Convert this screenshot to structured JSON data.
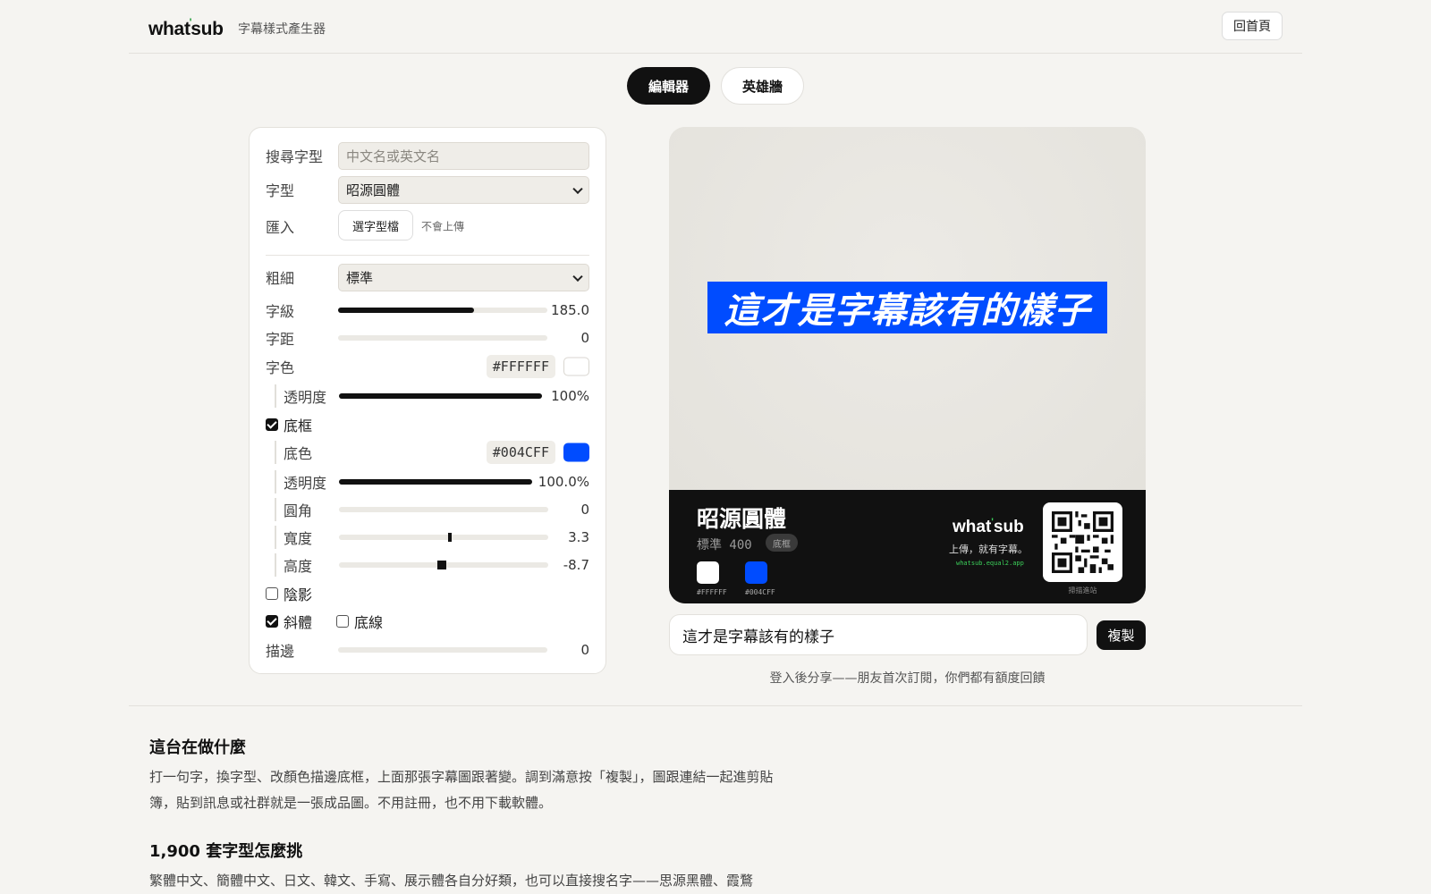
{
  "header": {
    "brand_pre": "what",
    "brand_tick": "'",
    "brand_post": "sub",
    "subtitle": "字幕樣式產生器",
    "home_label": "回首頁"
  },
  "tabs": [
    {
      "label": "編輯器",
      "active": true
    },
    {
      "label": "英雄牆",
      "active": false
    }
  ],
  "controls": {
    "search": {
      "label": "搜尋字型",
      "placeholder": "中文名或英文名"
    },
    "font": {
      "label": "字型",
      "value": "昭源圓體"
    },
    "import": {
      "label": "匯入",
      "button": "選字型檔",
      "hint": "不會上傳"
    },
    "weight": {
      "label": "粗細",
      "value": "標準"
    },
    "size": {
      "label": "字級",
      "value": "185.0",
      "fill": 0.65
    },
    "spacing": {
      "label": "字距",
      "value": "0",
      "fill": 0
    },
    "text_color": {
      "label": "字色",
      "hex": "#FFFFFF",
      "color": "#FFFFFF"
    },
    "text_opacity": {
      "label": "透明度",
      "value": "100%",
      "fill": 1.0
    },
    "box": {
      "label": "底框",
      "checked": true
    },
    "box_color": {
      "label": "底色",
      "hex": "#004CFF",
      "color": "#004CFF"
    },
    "box_opacity": {
      "label": "透明度",
      "value": "100.0%",
      "fill": 1.0
    },
    "radius": {
      "label": "圓角",
      "value": "0",
      "fill": 0
    },
    "width": {
      "label": "寬度",
      "value": "3.3",
      "knob": 0.52
    },
    "height": {
      "label": "高度",
      "value": "-8.7",
      "knob": 0.47
    },
    "shadow": {
      "label": "陰影",
      "checked": false
    },
    "italic": {
      "label": "斜體",
      "checked": true
    },
    "underline": {
      "label": "底線",
      "checked": false
    },
    "stroke": {
      "label": "描邊",
      "value": "0",
      "fill": 0
    }
  },
  "preview": {
    "caption": "這才是字幕該有的樣子",
    "caption_color": "#FFFFFF",
    "box_color": "#004CFF",
    "footer": {
      "font_name": "昭源圓體",
      "weight": "標準 400",
      "badge": "底框",
      "swatch1": {
        "hex": "#FFFFFF",
        "color": "#FFFFFF"
      },
      "swatch2": {
        "hex": "#004CFF",
        "color": "#004CFF"
      },
      "brand_pre": "what",
      "brand_tick": "'",
      "brand_post": "sub",
      "slogan": "上傳，就有字幕。",
      "url": "whatsub.equal2.app",
      "qr_label": "掃描進站"
    }
  },
  "text_input": {
    "value": "這才是字幕該有的樣子"
  },
  "copy_label": "複製",
  "share_note": "登入後分享——朋友首次訂閱，你們都有額度回饋",
  "sections": [
    {
      "title": "這台在做什麼",
      "body": "打一句字，換字型、改顏色描邊底框，上面那張字幕圖跟著變。調到滿意按「複製」，圖跟連結一起進剪貼簿，貼到訊息或社群就是一張成品圖。不用註冊，也不用下載軟體。"
    },
    {
      "title": "1,900 套字型怎麼挑",
      "body": "繁體中文、簡體中文、日文、韓文、手寫、展示體各自分好類，也可以直接搜名字——思源黑體、霞鶩"
    }
  ]
}
